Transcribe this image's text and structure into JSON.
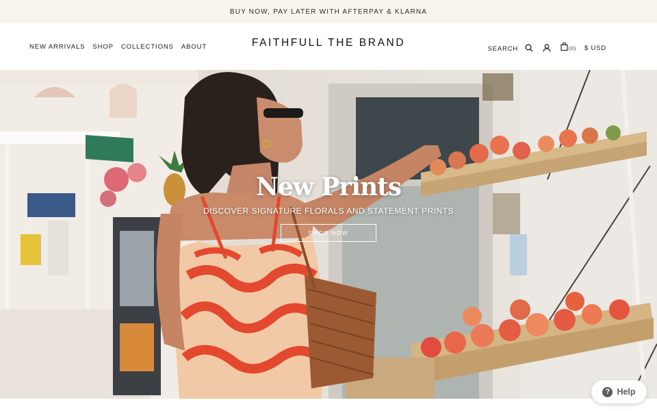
{
  "announcement": {
    "text": "BUY NOW, PAY LATER WITH AFTERPAY & KLARNA"
  },
  "header": {
    "nav": [
      "NEW ARRIVALS",
      "SHOP",
      "COLLECTIONS",
      "ABOUT"
    ],
    "logo": "FAITHFULL THE BRAND",
    "search_label": "SEARCH",
    "cart_count": "(0)",
    "currency": "$ USD"
  },
  "hero": {
    "title": "New Prints",
    "subtitle": "DISCOVER SIGNATURE FLORALS AND STATEMENT PRINTS",
    "cta": "SHOP NOW"
  },
  "help_widget": {
    "label": "Help",
    "icon": "question-icon"
  },
  "icons": [
    "search-icon",
    "user-icon",
    "bag-icon"
  ],
  "colors": {
    "announcement_bg": "#f7f5ee",
    "text": "#1a1a1a",
    "help_text": "#5c5c5c"
  }
}
